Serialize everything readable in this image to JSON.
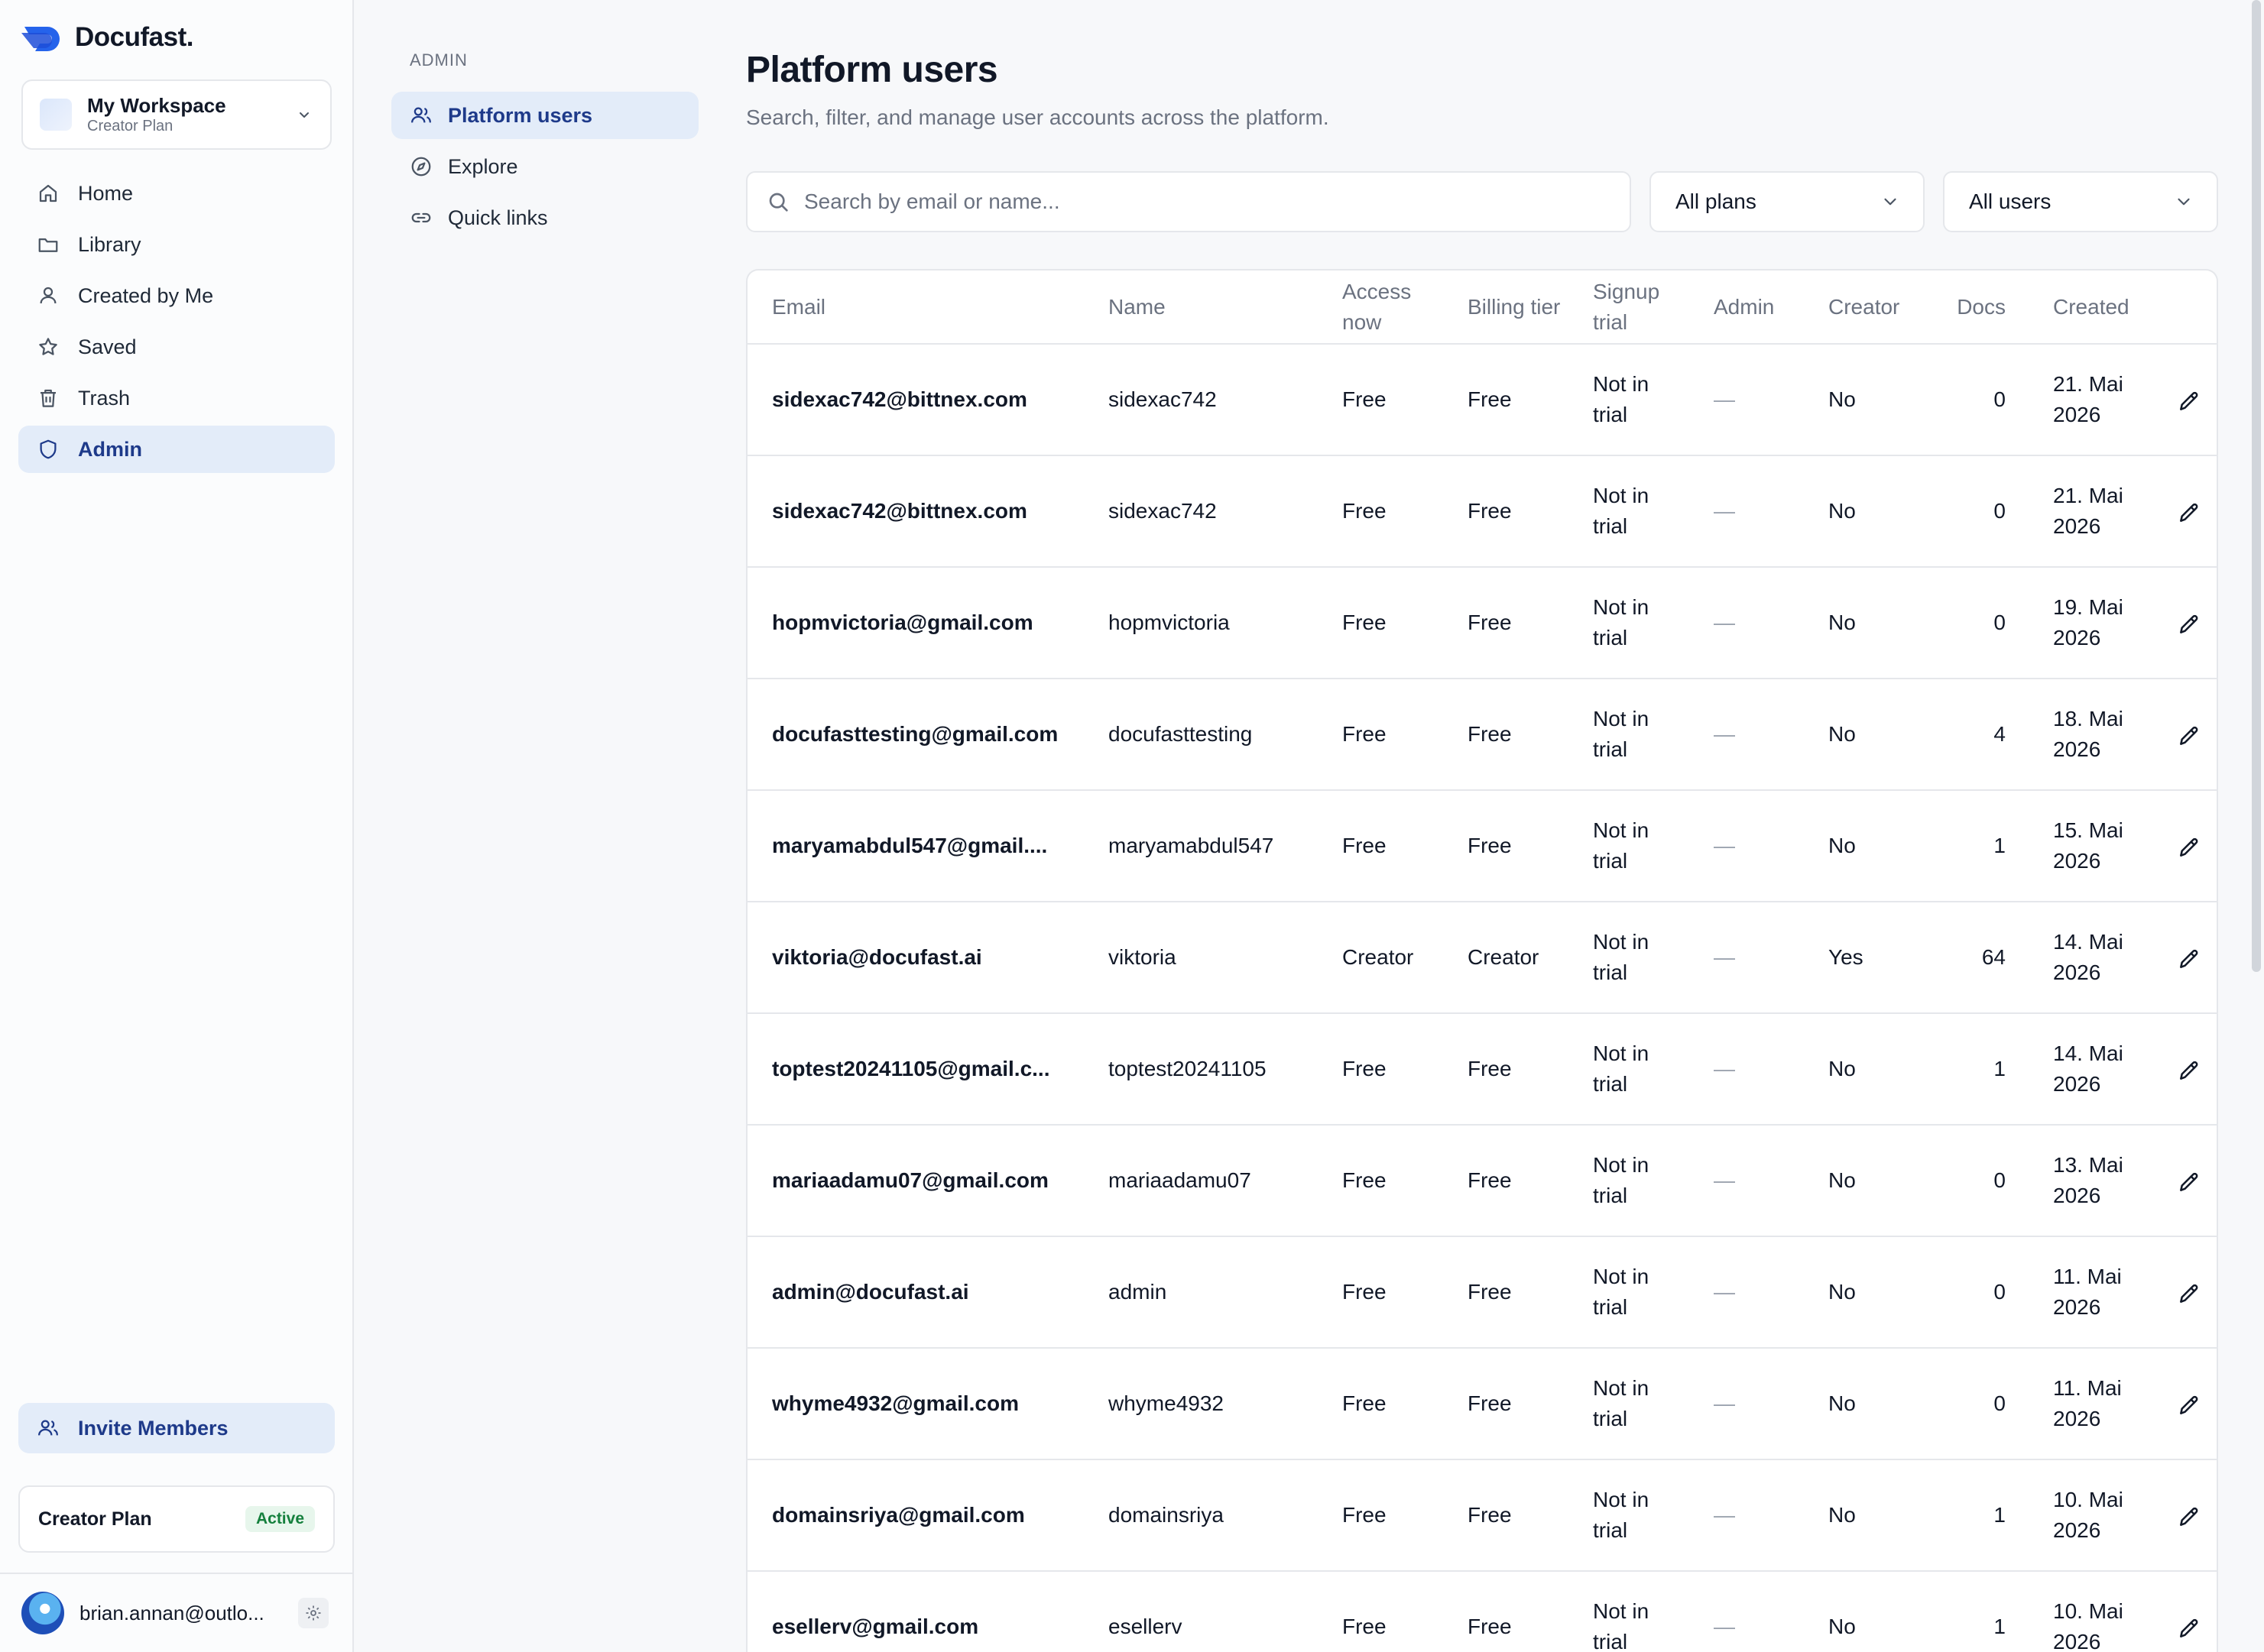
{
  "brand": {
    "name": "Docufast."
  },
  "workspace": {
    "name": "My Workspace",
    "plan": "Creator Plan"
  },
  "sidebar": {
    "items": [
      {
        "label": "Home",
        "icon": "home-icon"
      },
      {
        "label": "Library",
        "icon": "folder-icon"
      },
      {
        "label": "Created by Me",
        "icon": "user-icon"
      },
      {
        "label": "Saved",
        "icon": "star-icon"
      },
      {
        "label": "Trash",
        "icon": "trash-icon"
      },
      {
        "label": "Admin",
        "icon": "shield-icon",
        "active": true
      }
    ],
    "invite_label": "Invite Members",
    "plan_name": "Creator Plan",
    "plan_status": "Active",
    "user_email": "brian.annan@outlo..."
  },
  "subnav": {
    "heading": "ADMIN",
    "items": [
      {
        "label": "Platform users",
        "icon": "users-icon",
        "active": true
      },
      {
        "label": "Explore",
        "icon": "compass-icon"
      },
      {
        "label": "Quick links",
        "icon": "link-icon"
      }
    ]
  },
  "main": {
    "title": "Platform users",
    "subtitle": "Search, filter, and manage user accounts across the platform.",
    "search_placeholder": "Search by email or name...",
    "plan_filter": "All plans",
    "user_filter": "All users"
  },
  "table": {
    "columns": {
      "email": "Email",
      "name": "Name",
      "access": "Access now",
      "billing": "Billing tier",
      "trial": "Signup trial",
      "admin": "Admin",
      "creator": "Creator",
      "docs": "Docs",
      "created": "Created"
    },
    "rows": [
      {
        "email": "sidexac742@bittnex.com",
        "name": "sidexac742",
        "access": "Free",
        "billing": "Free",
        "trial": "Not in trial",
        "admin": "—",
        "creator": "No",
        "docs": "0",
        "created": "21. Mai 2026"
      },
      {
        "email": "sidexac742@bittnex.com",
        "name": "sidexac742",
        "access": "Free",
        "billing": "Free",
        "trial": "Not in trial",
        "admin": "—",
        "creator": "No",
        "docs": "0",
        "created": "21. Mai 2026"
      },
      {
        "email": "hopmvictoria@gmail.com",
        "name": "hopmvictoria",
        "access": "Free",
        "billing": "Free",
        "trial": "Not in trial",
        "admin": "—",
        "creator": "No",
        "docs": "0",
        "created": "19. Mai 2026"
      },
      {
        "email": "docufasttesting@gmail.com",
        "name": "docufasttesting",
        "access": "Free",
        "billing": "Free",
        "trial": "Not in trial",
        "admin": "—",
        "creator": "No",
        "docs": "4",
        "created": "18. Mai 2026"
      },
      {
        "email": "maryamabdul547@gmail....",
        "name": "maryamabdul547",
        "access": "Free",
        "billing": "Free",
        "trial": "Not in trial",
        "admin": "—",
        "creator": "No",
        "docs": "1",
        "created": "15. Mai 2026"
      },
      {
        "email": "viktoria@docufast.ai",
        "name": "viktoria",
        "access": "Creator",
        "billing": "Creator",
        "trial": "Not in trial",
        "admin": "—",
        "creator": "Yes",
        "docs": "64",
        "created": "14. Mai 2026"
      },
      {
        "email": "toptest20241105@gmail.c...",
        "name": "toptest20241105",
        "access": "Free",
        "billing": "Free",
        "trial": "Not in trial",
        "admin": "—",
        "creator": "No",
        "docs": "1",
        "created": "14. Mai 2026"
      },
      {
        "email": "mariaadamu07@gmail.com",
        "name": "mariaadamu07",
        "access": "Free",
        "billing": "Free",
        "trial": "Not in trial",
        "admin": "—",
        "creator": "No",
        "docs": "0",
        "created": "13. Mai 2026"
      },
      {
        "email": "admin@docufast.ai",
        "name": "admin",
        "access": "Free",
        "billing": "Free",
        "trial": "Not in trial",
        "admin": "—",
        "creator": "No",
        "docs": "0",
        "created": "11. Mai 2026"
      },
      {
        "email": "whyme4932@gmail.com",
        "name": "whyme4932",
        "access": "Free",
        "billing": "Free",
        "trial": "Not in trial",
        "admin": "—",
        "creator": "No",
        "docs": "0",
        "created": "11. Mai 2026"
      },
      {
        "email": "domainsriya@gmail.com",
        "name": "domainsriya",
        "access": "Free",
        "billing": "Free",
        "trial": "Not in trial",
        "admin": "—",
        "creator": "No",
        "docs": "1",
        "created": "10. Mai 2026"
      },
      {
        "email": "esellerv@gmail.com",
        "name": "esellerv",
        "access": "Free",
        "billing": "Free",
        "trial": "Not in trial",
        "admin": "—",
        "creator": "No",
        "docs": "1",
        "created": "10. Mai 2026"
      }
    ]
  },
  "colors": {
    "accent": "#1e3a8a",
    "accent_bg": "#e3ecf9",
    "active_badge": "#15803d",
    "brand_blue": "#2563eb"
  }
}
